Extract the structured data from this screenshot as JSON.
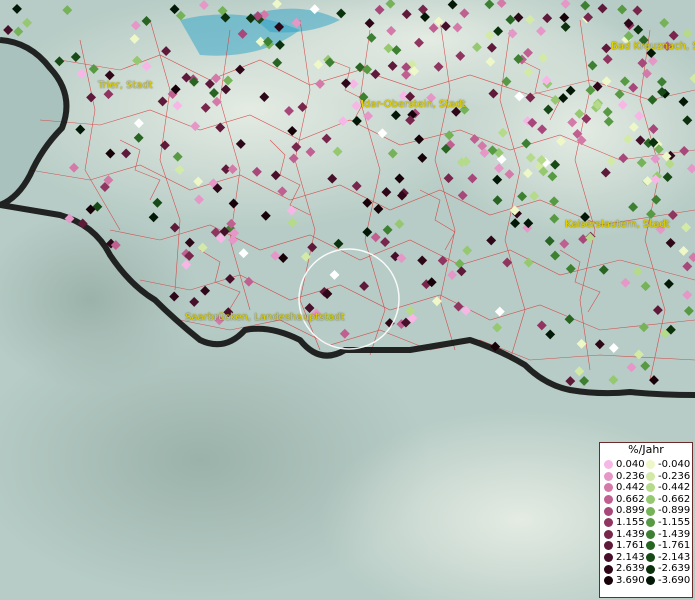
{
  "map": {
    "region_labels": [
      {
        "name": "Trier, Stadt"
      },
      {
        "name": "Idar-Oberstein, Stadt"
      },
      {
        "name": "Bad Kreuznach, S"
      },
      {
        "name": "Kaiserslautern, Stadt"
      },
      {
        "name": "Saarbrücken, Landeshauptstadt"
      }
    ],
    "colors": {
      "border": "#111111",
      "district_lines": "#d63a3a",
      "label": "#e0d400",
      "selection_ring": "#ffffff"
    }
  },
  "legend": {
    "title": "%/Jahr",
    "positive": [
      {
        "value": "0.040",
        "color": "#f7b7e6"
      },
      {
        "value": "0.236",
        "color": "#e597c8"
      },
      {
        "value": "0.442",
        "color": "#d47aa8"
      },
      {
        "value": "0.662",
        "color": "#c06090"
      },
      {
        "value": "0.899",
        "color": "#a8487a"
      },
      {
        "value": "1.155",
        "color": "#8f3560"
      },
      {
        "value": "1.439",
        "color": "#78264c"
      },
      {
        "value": "1.761",
        "color": "#5f1a3a"
      },
      {
        "value": "2.143",
        "color": "#46102a"
      },
      {
        "value": "2.639",
        "color": "#2e0818"
      },
      {
        "value": "3.690",
        "color": "#18020a"
      }
    ],
    "negative": [
      {
        "value": "-0.040",
        "color": "#eef7c8"
      },
      {
        "value": "-0.236",
        "color": "#d3eaa7"
      },
      {
        "value": "-0.442",
        "color": "#b4da8a"
      },
      {
        "value": "-0.662",
        "color": "#95c870"
      },
      {
        "value": "-0.899",
        "color": "#75b258"
      },
      {
        "value": "-1.155",
        "color": "#579a43"
      },
      {
        "value": "-1.439",
        "color": "#3d8032"
      },
      {
        "value": "-1.761",
        "color": "#286523"
      },
      {
        "value": "-2.143",
        "color": "#174a16"
      },
      {
        "value": "-2.639",
        "color": "#0b320d"
      },
      {
        "value": "-3.690",
        "color": "#031806"
      }
    ]
  }
}
